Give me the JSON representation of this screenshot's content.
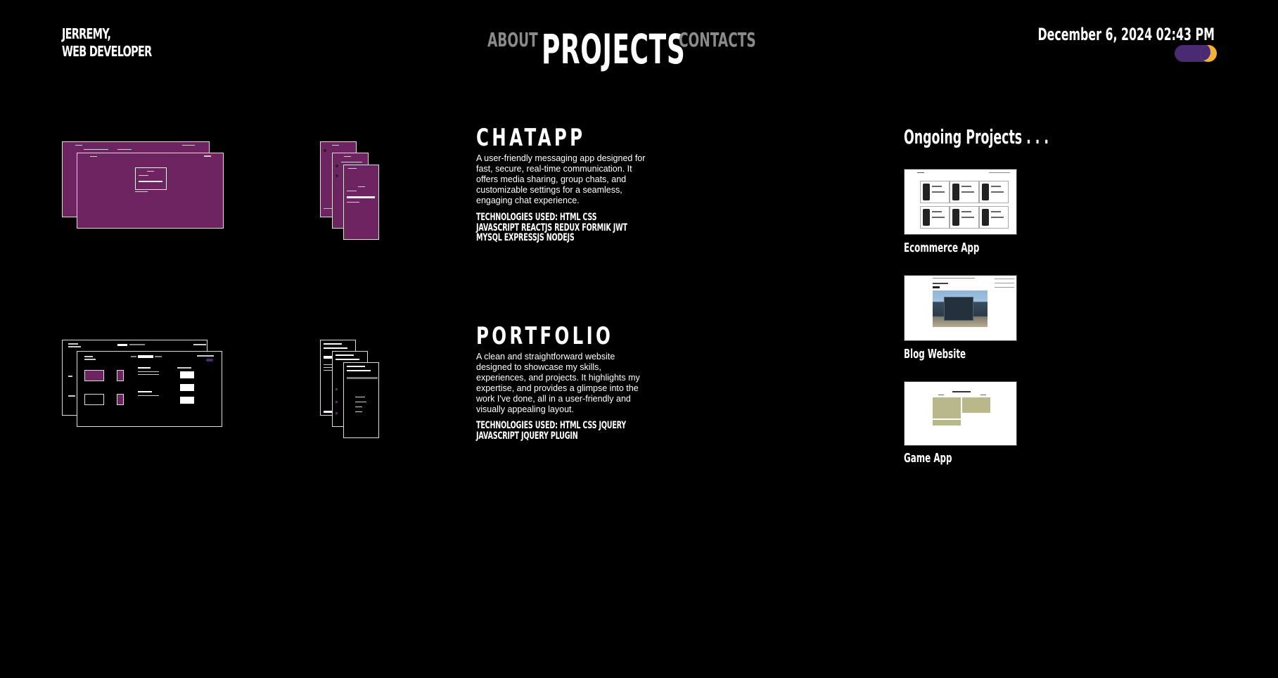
{
  "header": {
    "brand_line1": "JERREMY,",
    "brand_line2": "WEB DEVELOPER",
    "nav": {
      "about": "ABOUT",
      "projects": "PROJECTS",
      "contacts": "CONTACTS"
    },
    "datetime": "December 6, 2024 02:43 PM",
    "theme_toggle": {
      "state": "dark",
      "icon": "moon-icon",
      "track_color": "#4a2b73",
      "knob_color": "#f2b233"
    }
  },
  "projects": [
    {
      "title": "CHATAPP",
      "description": "A user-friendly messaging app designed for fast, secure, real-time communication. It offers media sharing, group chats, and customizable settings for a seamless, engaging chat experience.",
      "technologies": "TECHNOLOGIES USED: HTML CSS JAVASCRIPT REACTJS REDUX FORMIK JWT MYSQL EXPRESSJS NODEJS",
      "thumb_color": "#6e2461"
    },
    {
      "title": "PORTFOLIO",
      "description": "A clean and straightforward website designed to showcase my skills, experiences, and projects. It highlights my expertise, and provides a glimpse into the work I've done, all in a user-friendly and visually appealing layout.",
      "technologies": "TECHNOLOGIES USED: HTML CSS JQUERY JAVASCRIPT JQUERY PLUGIN",
      "thumb_color": "#000000"
    }
  ],
  "ongoing": {
    "title": "Ongoing Projects . . .",
    "items": [
      {
        "label": "Ecommerce App"
      },
      {
        "label": "Blog Website"
      },
      {
        "label": "Game App"
      }
    ]
  }
}
